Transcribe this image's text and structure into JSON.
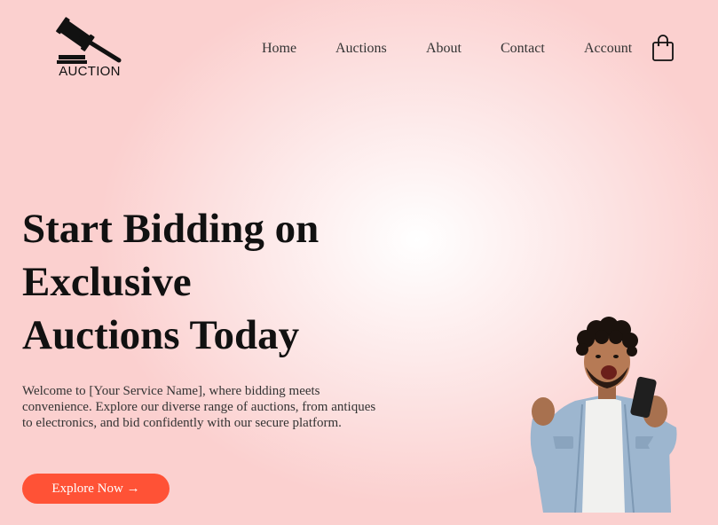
{
  "brand": {
    "logo_text": "AUCTION",
    "logo_icon": "gavel-icon"
  },
  "nav": {
    "items": [
      {
        "label": "Home"
      },
      {
        "label": "Auctions"
      },
      {
        "label": "About"
      },
      {
        "label": "Contact"
      },
      {
        "label": "Account"
      }
    ],
    "cart_icon": "shopping-bag-icon"
  },
  "hero": {
    "title_line1": "Start Bidding on",
    "title_line2": "Exclusive",
    "title_line3": "Auctions Today",
    "description": "Welcome to [Your Service Name], where bidding meets convenience. Explore our diverse range of auctions, from antiques to electronics, and bid confidently with our secure platform.",
    "cta_label": "Explore Now →",
    "image_icon": "excited-person-with-phone-illustration"
  },
  "colors": {
    "accent": "#ff5236",
    "background": "#fbd0cf",
    "text": "#111111"
  }
}
